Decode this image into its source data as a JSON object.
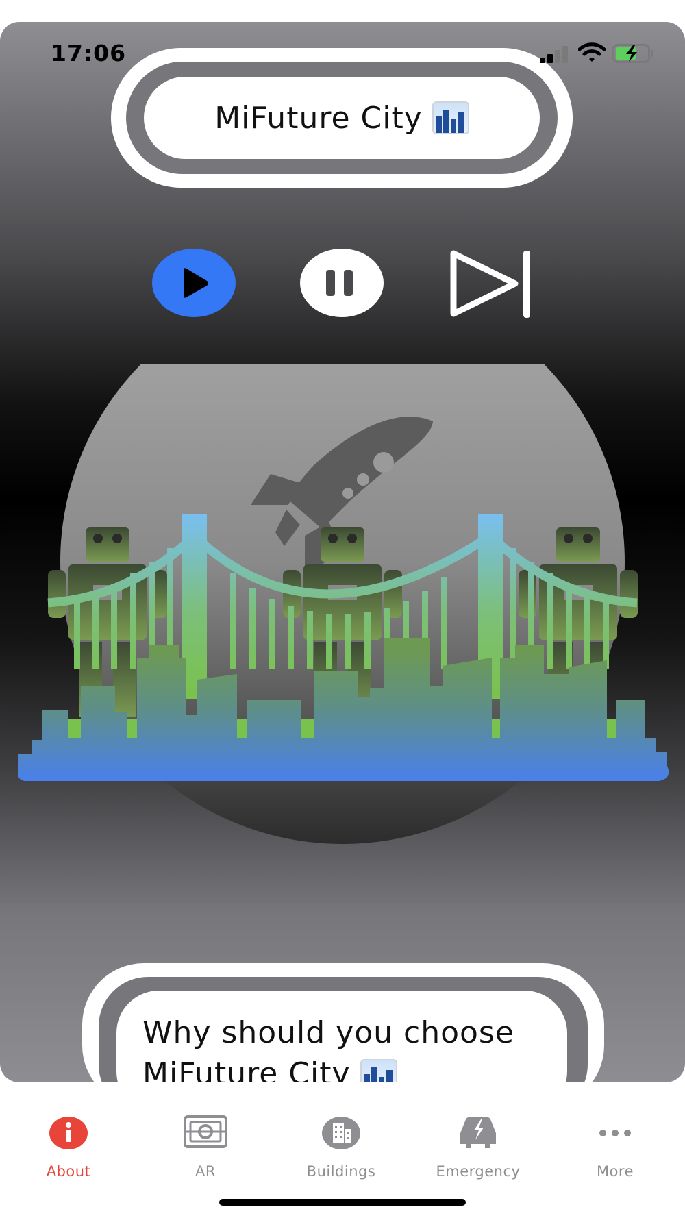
{
  "status_bar": {
    "time": "17:06"
  },
  "header": {
    "title": "MiFuture City"
  },
  "controls": {
    "play": "play-icon",
    "pause": "pause-icon",
    "next": "skip-forward-icon"
  },
  "hero": {
    "illustration": [
      "rocket-icon",
      "robot-icon",
      "bridge-icon",
      "city-skyline-icon"
    ]
  },
  "why_card": {
    "line1": "Why should you choose",
    "line2": "MiFuture City"
  },
  "tab_bar": {
    "tabs": [
      {
        "label": "About",
        "icon": "info-icon",
        "active": true
      },
      {
        "label": "AR",
        "icon": "ar-icon",
        "active": false
      },
      {
        "label": "Buildings",
        "icon": "buildings-icon",
        "active": false
      },
      {
        "label": "Emergency",
        "icon": "car-lightning-icon",
        "active": false
      },
      {
        "label": "More",
        "icon": "more-icon",
        "active": false
      }
    ]
  },
  "colors": {
    "accent_blue": "#3478f6",
    "active_tab": "#e9443a",
    "inactive_tab": "#8e8e93",
    "gradient_top": "#79bff0",
    "gradient_mid": "#7ab86e",
    "gradient_bottom": "#4a80ea"
  }
}
